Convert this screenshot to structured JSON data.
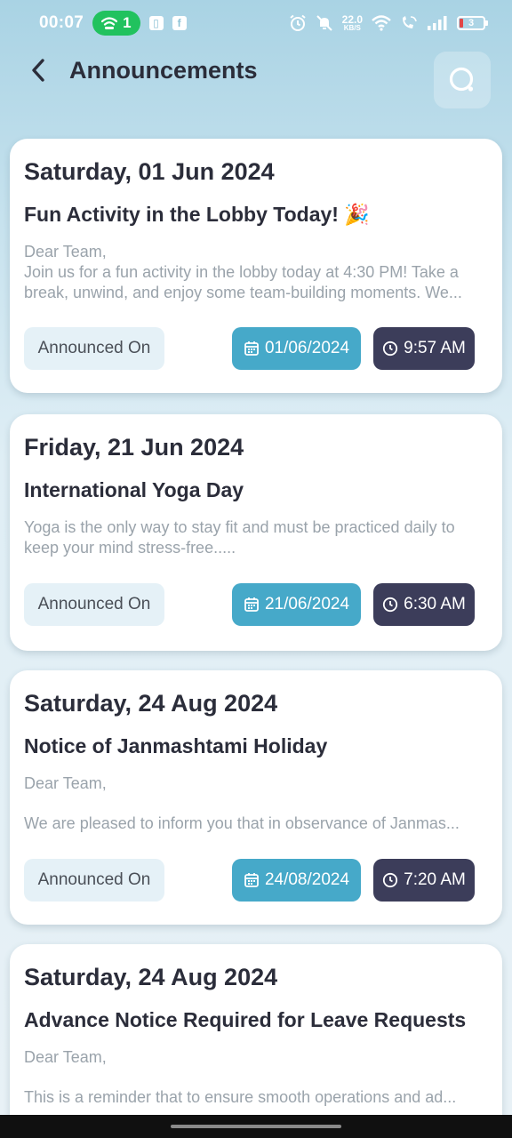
{
  "status_bar": {
    "time": "00:07",
    "hotspot_count": "1",
    "net_speed_value": "22.0",
    "net_speed_unit": "KB/S",
    "battery_level": "3"
  },
  "header": {
    "title": "Announcements",
    "back_icon": "chevron-left-icon",
    "search_icon": "search-icon"
  },
  "colors": {
    "date_chip": "#46a9c9",
    "time_chip": "#3c3d5a",
    "announced_chip": "#e5f1f7"
  },
  "announcements": [
    {
      "day_date": "Saturday, 01 Jun 2024",
      "title": "Fun Activity in the Lobby Today! 🎉",
      "body": [
        "Dear Team,",
        "Join us for a fun activity in the lobby today at 4:30 PM! Take a",
        "break, unwind, and enjoy some team-building moments. We..."
      ],
      "announced_label": "Announced On",
      "date": "01/06/2024",
      "time": "9:57 AM"
    },
    {
      "day_date": "Friday, 21 Jun 2024",
      "title": "International Yoga Day",
      "body": [
        "Yoga is the only way to stay fit and must be practiced daily to",
        "keep your mind stress-free....."
      ],
      "announced_label": "Announced On",
      "date": "21/06/2024",
      "time": "6:30 AM"
    },
    {
      "day_date": "Saturday, 24 Aug 2024",
      "title": "Notice of Janmashtami Holiday",
      "body": [
        "Dear Team,",
        "",
        "We are pleased to inform you that in observance of Janmas..."
      ],
      "announced_label": "Announced On",
      "date": "24/08/2024",
      "time": "7:20 AM"
    },
    {
      "day_date": "Saturday, 24 Aug 2024",
      "title": "Advance Notice Required for Leave Requests",
      "body": [
        "Dear Team,",
        "",
        "This is a reminder that to ensure smooth operations and ad..."
      ]
    }
  ]
}
